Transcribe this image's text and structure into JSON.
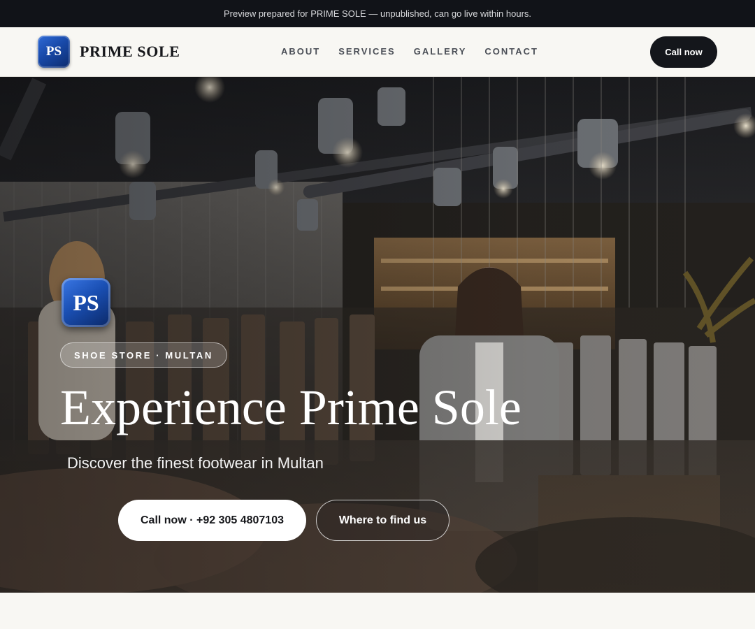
{
  "banner": {
    "text": "Preview prepared for PRIME SOLE — unpublished, can go live within hours."
  },
  "nav": {
    "logo_initials": "PS",
    "brand": "PRIME SOLE",
    "links": [
      "ABOUT",
      "SERVICES",
      "GALLERY",
      "CONTACT"
    ],
    "cta": "Call now"
  },
  "hero": {
    "logo_initials": "PS",
    "tag": "SHOE STORE · MULTAN",
    "title": "Experience Prime Sole",
    "subtitle": "Discover the finest footwear in Multan",
    "primary_cta": "Call now · +92 305 4807103",
    "secondary_cta": "Where to find us"
  },
  "colors": {
    "dark": "#111318",
    "accent_blue": "#1a4fb3",
    "page_bg": "#f8f7f3"
  }
}
